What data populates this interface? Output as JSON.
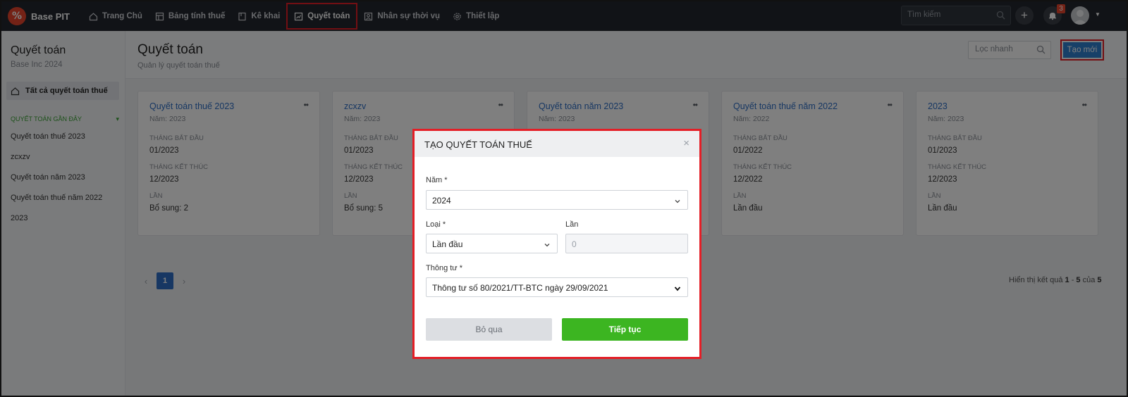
{
  "app": {
    "logo_glyph": "%",
    "name": "Base PIT"
  },
  "nav": {
    "items": [
      {
        "label": "Trang Chủ",
        "icon": "home-icon"
      },
      {
        "label": "Bảng tính thuế",
        "icon": "table-icon"
      },
      {
        "label": "Kê khai",
        "icon": "book-icon"
      },
      {
        "label": "Quyết toán",
        "icon": "report-icon",
        "active": true
      },
      {
        "label": "Nhân sự thời vụ",
        "icon": "person-icon"
      },
      {
        "label": "Thiết lập",
        "icon": "gear-icon"
      }
    ],
    "search_placeholder": "Tìm kiếm",
    "notification_count": "3"
  },
  "sidebar": {
    "title": "Quyết toán",
    "subtitle": "Base Inc 2024",
    "all_label": "Tất cả quyết toán thuế",
    "section_label": "QUYẾT TOÁN GẦN ĐÂY",
    "items": [
      "Quyết toán thuế 2023",
      "zcxzv",
      "Quyết toán năm 2023",
      "Quyết toán thuế năm 2022",
      "2023"
    ]
  },
  "page": {
    "title": "Quyết toán",
    "subtitle": "Quản lý quyết toán thuế",
    "quick_filter_placeholder": "Lọc nhanh",
    "create_label": "Tạo mới"
  },
  "card_labels": {
    "start": "THÁNG BẮT ĐẦU",
    "end": "THÁNG KẾT THÚC",
    "times": "LẦN"
  },
  "cards": [
    {
      "title": "Quyết toán thuế 2023",
      "year": "Năm: 2023",
      "start": "01/2023",
      "end": "12/2023",
      "times": "Bổ sung: 2"
    },
    {
      "title": "zcxzv",
      "year": "Năm: 2023",
      "start": "01/2023",
      "end": "12/2023",
      "times": "Bổ sung: 5"
    },
    {
      "title": "Quyết toán năm 2023",
      "year": "Năm: 2023",
      "start": "",
      "end": "",
      "times": ""
    },
    {
      "title": "Quyết toán thuế năm 2022",
      "year": "Năm: 2022",
      "start": "01/2022",
      "end": "12/2022",
      "times": "Lần đầu"
    },
    {
      "title": "2023",
      "year": "Năm: 2023",
      "start": "01/2023",
      "end": "12/2023",
      "times": "Lần đầu"
    }
  ],
  "pagination": {
    "current_page": "1",
    "info_prefix": "Hiển thị kết quả",
    "from": "1",
    "dash": "-",
    "to": "5",
    "of": "của",
    "total": "5"
  },
  "modal": {
    "title": "TẠO QUYẾT TOÁN THUẾ",
    "year_label": "Năm *",
    "year_value": "2024",
    "type_label": "Loại *",
    "type_value": "Lần đầu",
    "times_label": "Lần",
    "times_placeholder": "0",
    "circular_label": "Thông tư *",
    "circular_value": "Thông tư số 80/2021/TT-BTC ngày 29/09/2021",
    "cancel_label": "Bỏ qua",
    "continue_label": "Tiếp tục"
  },
  "colors": {
    "topbar": "#23272e",
    "accent_blue": "#2f80d0",
    "continue_green": "#3cb521",
    "highlight_red": "#e41e26",
    "logo_red": "#e8452c"
  }
}
